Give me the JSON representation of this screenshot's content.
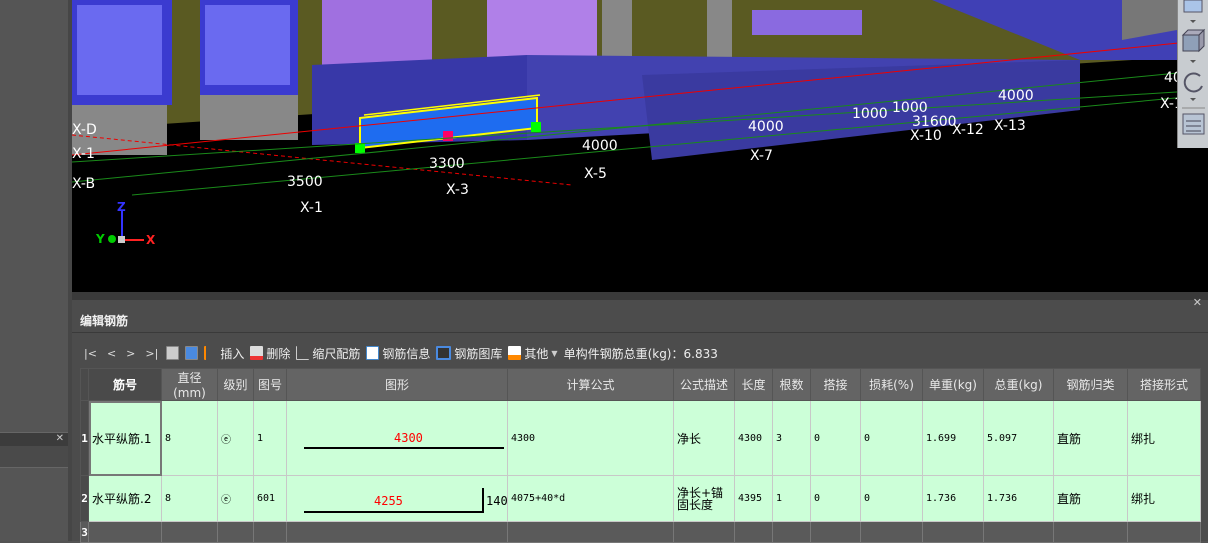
{
  "viewport": {
    "axis_labels": {
      "x": "X",
      "y": "Y",
      "z": "Z"
    },
    "grid_labels": [
      "X-D",
      "X-1",
      "X-B",
      "X-1",
      "X-3",
      "X-5",
      "X-7",
      "X-10",
      "X-12",
      "X-13",
      "X-1"
    ],
    "dimensions": [
      "3500",
      "3300",
      "4000",
      "4000",
      "1000",
      "1000",
      "31600",
      "4000",
      "40"
    ]
  },
  "panel": {
    "title": "编辑钢筋",
    "toolbar": {
      "nav": [
        "|<",
        "<",
        ">",
        ">|"
      ],
      "insert": "插入",
      "delete": "删除",
      "scale": "缩尺配筋",
      "info": "钢筋信息",
      "library": "钢筋图库",
      "other": "其他",
      "total_weight_label": "单构件钢筋总重(kg)：6.833"
    },
    "columns": [
      "筋号",
      "直径(mm)",
      "级别",
      "图号",
      "图形",
      "计算公式",
      "公式描述",
      "长度",
      "根数",
      "搭接",
      "损耗(%)",
      "单重(kg)",
      "总重(kg)",
      "钢筋归类",
      "搭接形式"
    ],
    "rows": [
      {
        "idx": "1",
        "name": "水平纵筋.1",
        "dia": "8",
        "grade": "ⓔ",
        "fig": "1",
        "shape_main": "4300",
        "shape_side": "",
        "formula": "4300",
        "desc": "净长",
        "len": "4300",
        "count": "3",
        "lap": "0",
        "loss": "0",
        "unit_w": "1.699",
        "total_w": "5.097",
        "type": "直筋",
        "lap_form": "绑扎"
      },
      {
        "idx": "2",
        "name": "水平纵筋.2",
        "dia": "8",
        "grade": "ⓔ",
        "fig": "601",
        "shape_main": "4255",
        "shape_side": "140",
        "formula": "4075+40*d",
        "desc": "净长+锚固长度",
        "len": "4395",
        "count": "1",
        "lap": "0",
        "loss": "0",
        "unit_w": "1.736",
        "total_w": "1.736",
        "type": "直筋",
        "lap_form": "绑扎"
      }
    ],
    "empty_row_idx": "3"
  }
}
